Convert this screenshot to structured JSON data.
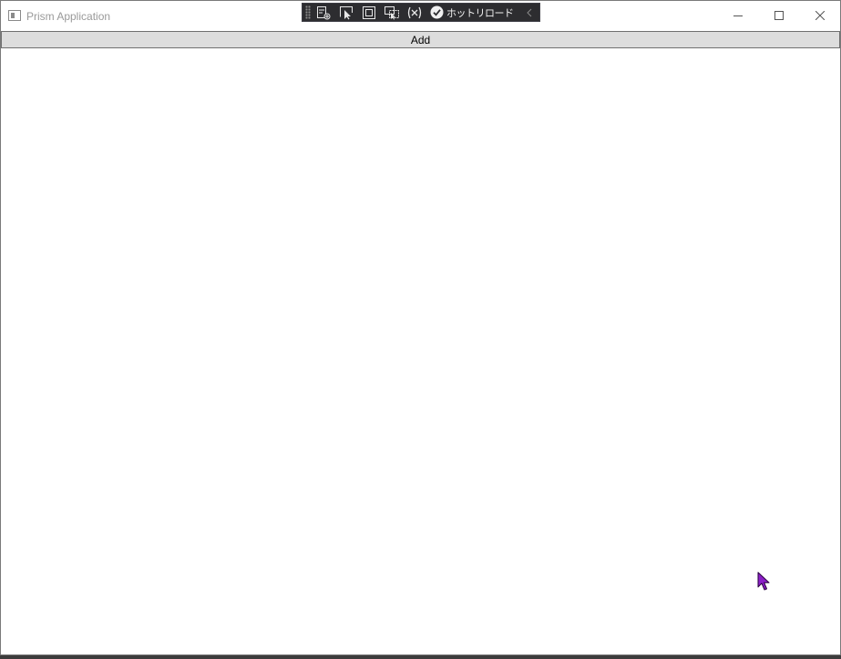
{
  "window": {
    "title": "Prism Application"
  },
  "devtools": {
    "hot_reload_label": "ホットリロード",
    "icons": [
      "live-visual-tree-icon",
      "select-element-icon",
      "display-adorners-icon",
      "track-focus-icon",
      "binding-failures-icon",
      "hot-reload-check-icon",
      "collapse-chevron-icon"
    ]
  },
  "toolbar": {
    "add_label": "Add"
  },
  "colors": {
    "devbar_bg": "#2d2d30",
    "button_bg": "#dddddd",
    "cursor": "#8b1fc7"
  }
}
